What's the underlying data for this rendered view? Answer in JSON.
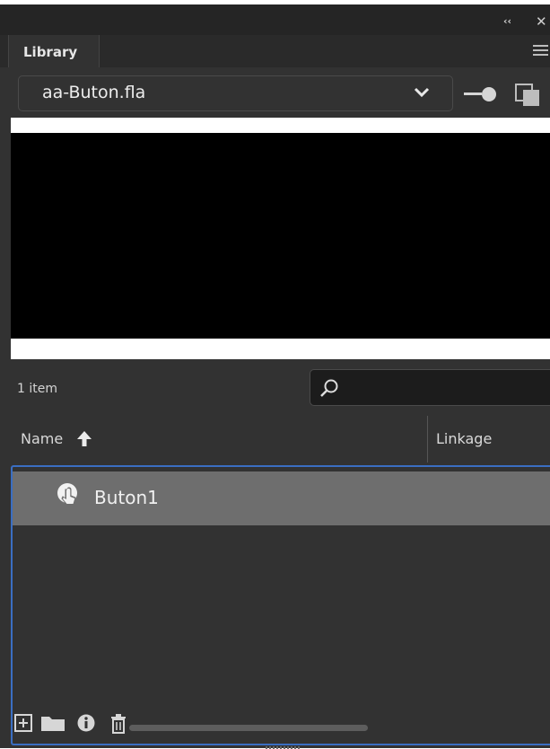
{
  "panel": {
    "tab_label": "Library",
    "collapse_glyph": "‹‹",
    "close_glyph": "✕"
  },
  "document_select": {
    "value": "aa-Buton.fla"
  },
  "library": {
    "item_count": "1 item",
    "search_placeholder": "",
    "columns": {
      "name": "Name",
      "linkage": "Linkage"
    },
    "items": [
      {
        "label": "Buton1",
        "icon": "button-symbol-icon"
      }
    ]
  },
  "icons": {
    "collapse": "double-chevron-left-icon",
    "close": "close-icon",
    "panel_menu": "hamburger-menu-icon",
    "dropdown": "chevron-down-icon",
    "pin": "pin-icon",
    "new_library": "new-library-panel-icon",
    "search": "search-icon",
    "sort": "sort-ascending-icon",
    "new_symbol": "new-symbol-icon",
    "new_folder": "folder-icon",
    "properties": "info-icon",
    "delete": "trash-icon"
  },
  "colors": {
    "panel_bg": "#323232",
    "selection_bg": "#6e6e6e",
    "focus_border": "#3a6ec2"
  }
}
